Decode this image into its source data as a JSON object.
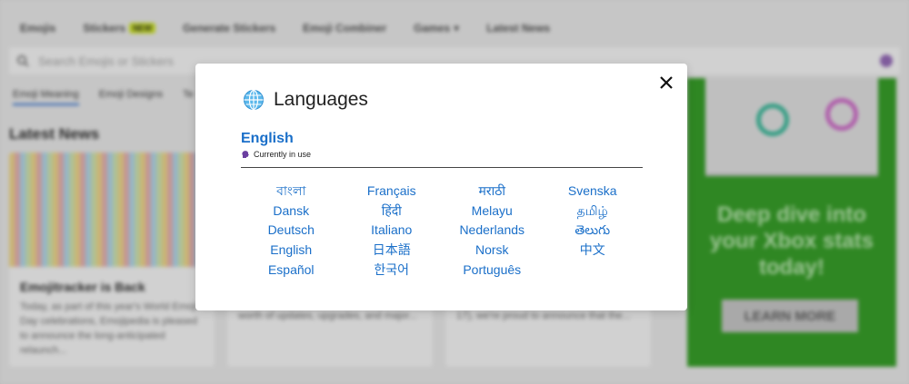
{
  "background": {
    "nav": [
      {
        "label": "Emojis"
      },
      {
        "label": "Stickers",
        "badge": "NEW"
      },
      {
        "label": "Generate Stickers"
      },
      {
        "label": "Emoji Combiner"
      },
      {
        "label": "Games"
      },
      {
        "label": "Latest News"
      }
    ],
    "search_placeholder": "Search Emojis or Stickers",
    "subtabs": [
      "Emoji Meaning",
      "Emoji Designs",
      "Te"
    ],
    "latest_news_title": "Latest News",
    "cards": [
      {
        "title": "Emojitracker is Back",
        "text": "Today, as part of this year's World Emoji Day celebrations, Emojipedia is pleased to announce the long-anticipated relaunch..."
      },
      {
        "title": "",
        "text": "Yasha's custom emoji art is just cool: a decade old, but it's seen a lifetime's worth of updates, upgrades, and major..."
      },
      {
        "title": "",
        "text": "Today, as part of our annual World Emoji Awards ahead of World Emoji Day (July 17), we're proud to announce that the..."
      }
    ],
    "ad": {
      "headline": "Deep dive into your Xbox stats today!",
      "cta": "LEARN MORE"
    }
  },
  "modal": {
    "title": "Languages",
    "globe_icon": "globe-icon",
    "current_language": "English",
    "current_note": "Currently in use",
    "columns": [
      [
        "বাংলা",
        "Dansk",
        "Deutsch",
        "English",
        "Español"
      ],
      [
        "Français",
        "हिंदी",
        "Italiano",
        "日本語",
        "한국어"
      ],
      [
        "मराठी",
        "Melayu",
        "Nederlands",
        "Norsk",
        "Português"
      ],
      [
        "Svenska",
        "தமிழ்",
        "తెలుగు",
        "中文"
      ]
    ]
  },
  "colors": {
    "link": "#1a6fc9",
    "ad_green": "#3aa52b"
  }
}
